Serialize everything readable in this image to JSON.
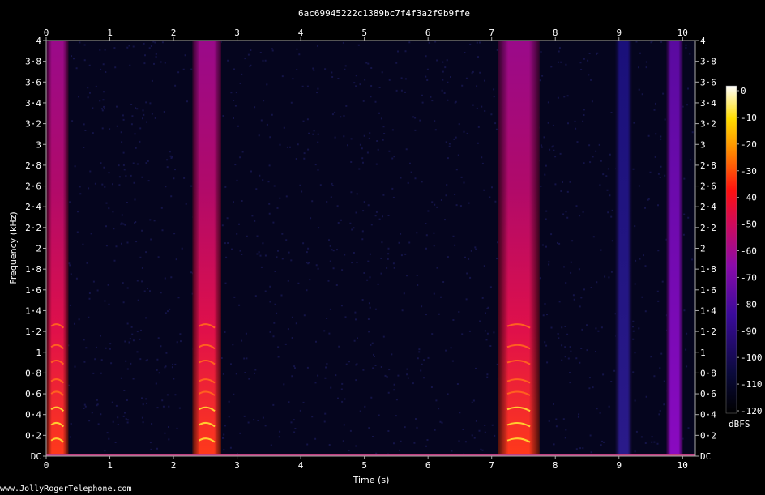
{
  "chart_data": {
    "type": "heatmap",
    "title": "6ac69945222c1389bc7f4f3a2f9b9ffe",
    "xlabel": "Time (s)",
    "ylabel": "Frequency (kHz)",
    "xlim": [
      0,
      10.2
    ],
    "ylim": [
      0,
      4
    ],
    "x_ticks": [
      "0",
      "1",
      "2",
      "3",
      "4",
      "5",
      "6",
      "7",
      "8",
      "9",
      "10"
    ],
    "y_ticks": [
      "DC",
      "0·2",
      "0·4",
      "0·6",
      "0·8",
      "1",
      "1·2",
      "1·4",
      "1·6",
      "1·8",
      "2",
      "2·2",
      "2·4",
      "2·6",
      "2·8",
      "3",
      "3·2",
      "3·4",
      "3·6",
      "3·8",
      "4"
    ],
    "colorbar": {
      "label": "dBFS",
      "ticks": [
        "0",
        "-10",
        "-20",
        "-30",
        "-40",
        "-50",
        "-60",
        "-70",
        "-80",
        "-90",
        "-100",
        "-110",
        "-120"
      ],
      "range": [
        -120,
        0
      ]
    },
    "segments": [
      {
        "start": 0.0,
        "end": 0.35,
        "level": "high"
      },
      {
        "start": 2.3,
        "end": 2.75,
        "level": "high"
      },
      {
        "start": 7.1,
        "end": 7.75,
        "level": "high"
      },
      {
        "start": 8.95,
        "end": 9.2,
        "level": "low"
      },
      {
        "start": 9.75,
        "end": 10.0,
        "level": "medium"
      }
    ]
  },
  "watermark": "www.JollyRogerTelephone.com"
}
